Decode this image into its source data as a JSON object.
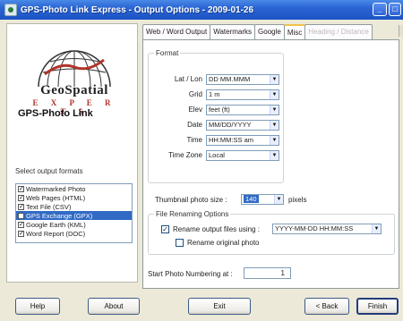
{
  "window": {
    "title": "GPS-Photo Link Express - Output Options - 2009-01-26",
    "minimize_glyph": "_",
    "maximize_glyph": "□"
  },
  "logo": {
    "word": "GeoSpatial",
    "tagline": "E X P E R T S"
  },
  "brand": "GPS-Photo Link",
  "sidebar": {
    "select_label": "Select output formats",
    "formats": [
      {
        "label": "Watermarked Photo",
        "checked": true,
        "selected": false
      },
      {
        "label": "Web Pages (HTML)",
        "checked": true,
        "selected": false
      },
      {
        "label": "Text File (CSV)",
        "checked": true,
        "selected": false
      },
      {
        "label": "GPS Exchange (GPX)",
        "checked": false,
        "selected": true
      },
      {
        "label": "Google Earth (KML)",
        "checked": true,
        "selected": false
      },
      {
        "label": "Word Report (DOC)",
        "checked": true,
        "selected": false
      }
    ]
  },
  "tabs": [
    {
      "label": "Web / Word Output",
      "active": false,
      "disabled": false
    },
    {
      "label": "Watermarks",
      "active": false,
      "disabled": false
    },
    {
      "label": "Google",
      "active": false,
      "disabled": false
    },
    {
      "label": "Misc",
      "active": true,
      "disabled": false
    },
    {
      "label": "Heading / Distance",
      "active": false,
      "disabled": true
    }
  ],
  "format": {
    "legend": "Format",
    "latlon_label": "Lat / Lon",
    "latlon_value": "DD MM.MMM",
    "grid_label": "Grid",
    "grid_value": "1 m",
    "elev_label": "Elev",
    "elev_value": "feet (ft)",
    "date_label": "Date",
    "date_value": "MM/DD/YYYY",
    "time_label": "Time",
    "time_value": "HH:MM:SS am",
    "tz_label": "Time Zone",
    "tz_value": "Local"
  },
  "thumbnail": {
    "label": "Thumbnail photo size :",
    "value": "140",
    "unit": "pixels"
  },
  "renaming": {
    "legend": "File Renaming Options",
    "rename_label": "Rename output files using :",
    "rename_checked": true,
    "pattern": "YYYY-MM-DD HH:MM:SS",
    "rename_original_label": "Rename original photo",
    "rename_original_checked": false
  },
  "numbering": {
    "label": "Start Photo Numbering at :",
    "value": "1"
  },
  "buttons": {
    "help": "Help",
    "about": "About",
    "exit": "Exit",
    "back": "< Back",
    "finish": "Finish"
  },
  "colors": {
    "titlebar": "#2a64d4",
    "selection": "#316ac5",
    "logo_accent": "#b0342b"
  }
}
